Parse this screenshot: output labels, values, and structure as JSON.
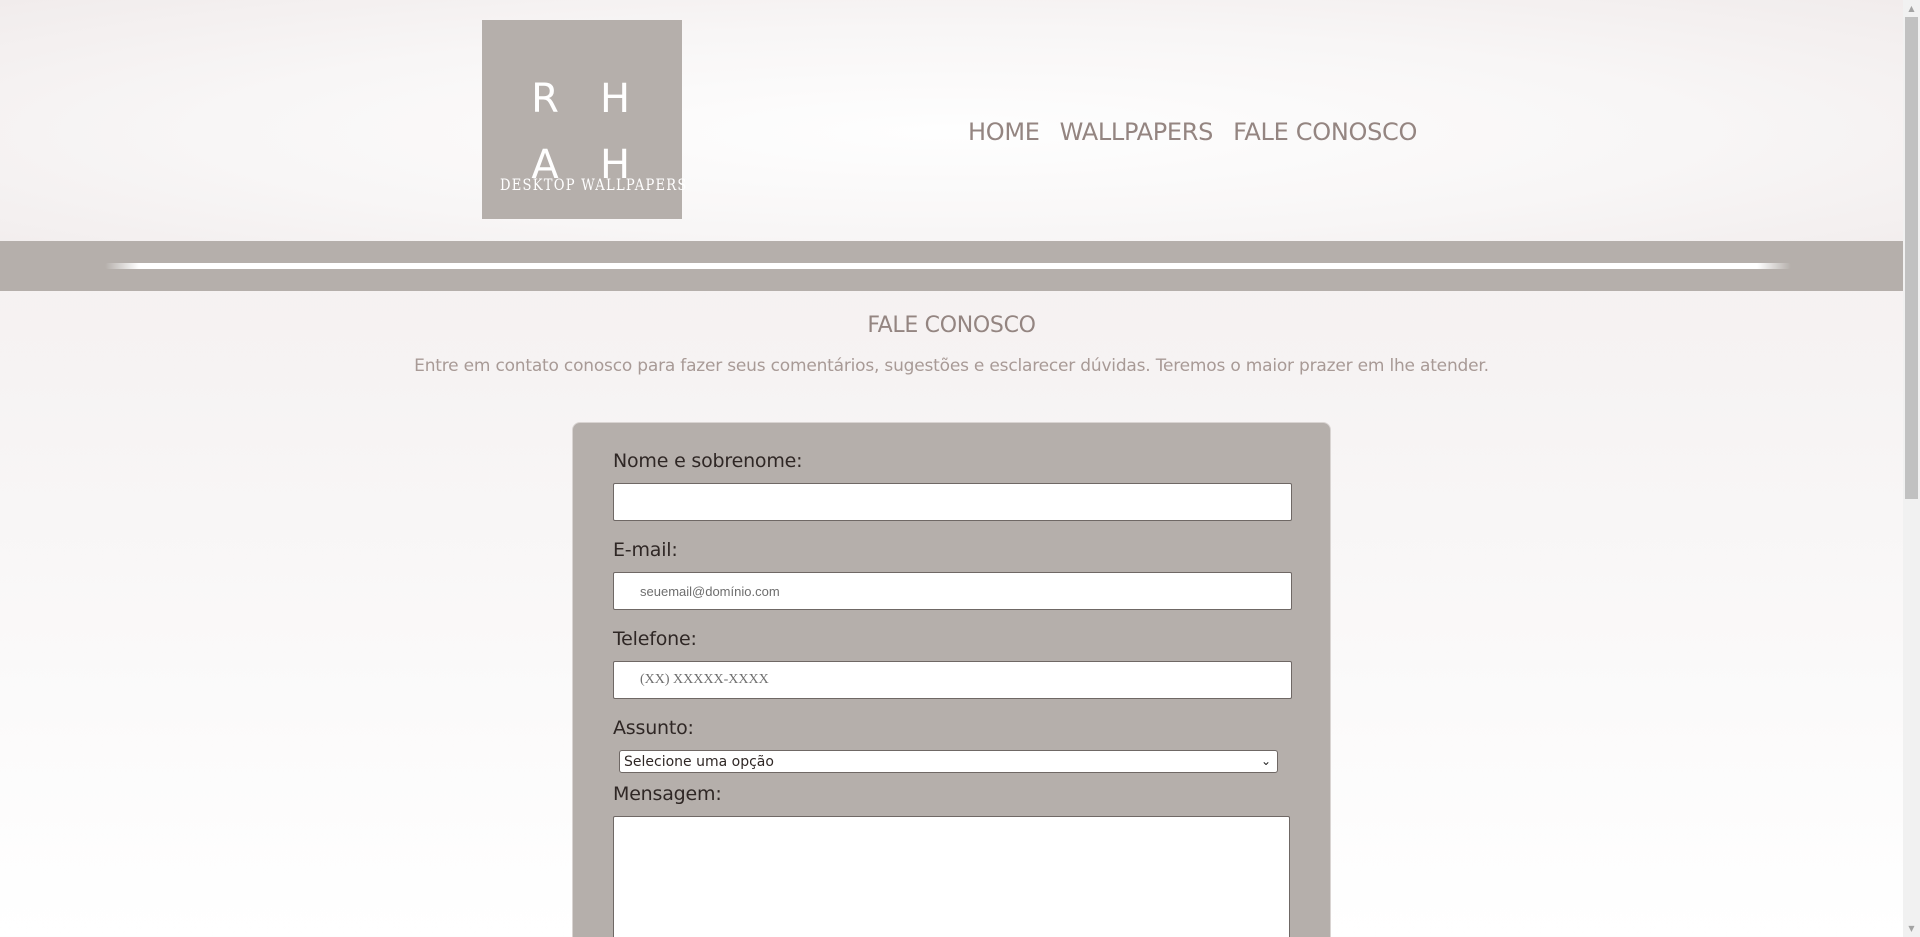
{
  "logo": {
    "letters": [
      "R",
      "H",
      "A",
      "H"
    ],
    "subtitle": "DESKTOP WALLPAPERS"
  },
  "nav": {
    "items": [
      {
        "label": "HOME"
      },
      {
        "label": "WALLPAPERS"
      },
      {
        "label": "FALE CONOSCO"
      }
    ]
  },
  "page": {
    "title": "FALE CONOSCO",
    "description": "Entre em contato conosco para fazer seus comentários, sugestões e esclarecer dúvidas. Teremos o maior prazer em lhe atender."
  },
  "form": {
    "name_label": "Nome e sobrenome:",
    "name_value": "",
    "email_label": "E-mail:",
    "email_placeholder": "seuemail@domínio.com",
    "phone_label": "Telefone:",
    "phone_placeholder": "(XX) XXXXX-XXXX",
    "subject_label": "Assunto:",
    "subject_selected": "Selecione uma opção",
    "message_label": "Mensagem:",
    "message_value": ""
  },
  "colors": {
    "logo_bg": "#b5afab",
    "nav_text": "#948581",
    "band": "#b5afab",
    "form_bg": "#b5afab",
    "label_text": "#2f2725"
  },
  "icons": {
    "select_arrow": "chevron-down-icon",
    "scroll_up": "scroll-up-arrow-icon",
    "scroll_down": "scroll-down-arrow-icon"
  }
}
